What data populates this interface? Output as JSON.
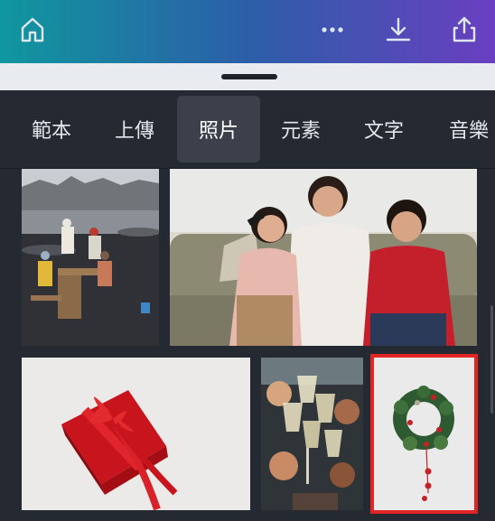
{
  "topbar": {
    "icons": [
      "home-icon",
      "more-icon",
      "download-icon",
      "share-icon"
    ],
    "colors": {
      "start": "#10979e",
      "end": "#6a3fc1"
    }
  },
  "tabs": [
    {
      "label": "範本",
      "active": false
    },
    {
      "label": "上傳",
      "active": false
    },
    {
      "label": "照片",
      "active": true
    },
    {
      "label": "元素",
      "active": false
    },
    {
      "label": "文字",
      "active": false
    },
    {
      "label": "音樂",
      "active": false
    }
  ],
  "photos": [
    {
      "subject": "family-picnic-on-black-sand-beach"
    },
    {
      "subject": "mother-and-children-on-sofa-with-remote"
    },
    {
      "subject": "red-gift-box-with-ribbon"
    },
    {
      "subject": "champagne-toast"
    },
    {
      "subject": "christmas-wreath-with-red-ornaments",
      "selected": true
    }
  ],
  "selection_color": "#e32424"
}
